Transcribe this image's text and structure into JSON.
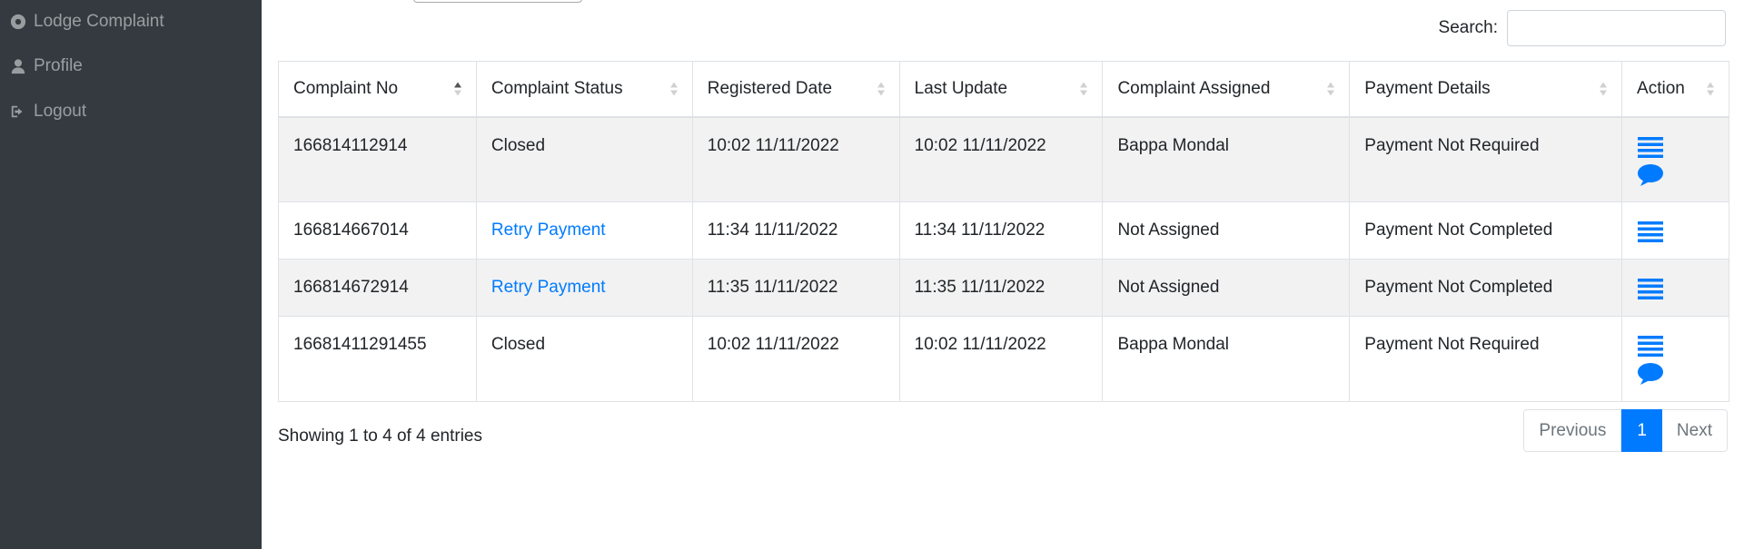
{
  "sidebar": {
    "items": [
      {
        "label": "Lodge Complaint",
        "icon": "dot-circle-icon"
      },
      {
        "label": "Profile",
        "icon": "user-icon"
      },
      {
        "label": "Logout",
        "icon": "sign-out-icon"
      }
    ]
  },
  "search": {
    "label": "Search:",
    "value": ""
  },
  "table": {
    "headers": [
      "Complaint No",
      "Complaint Status",
      "Registered Date",
      "Last Update",
      "Complaint Assigned",
      "Payment Details",
      "Action"
    ],
    "rows": [
      {
        "no": "166814112914",
        "status": "Closed",
        "registered": "10:02 11/11/2022",
        "updated": "10:02 11/11/2022",
        "assigned": "Bappa Mondal",
        "payment": "Payment Not Required"
      },
      {
        "no": "166814667014",
        "status": "Retry Payment",
        "registered": "11:34 11/11/2022",
        "updated": "11:34 11/11/2022",
        "assigned": "Not Assigned",
        "payment": "Payment Not Completed"
      },
      {
        "no": "166814672914",
        "status": "Retry Payment",
        "registered": "11:35 11/11/2022",
        "updated": "11:35 11/11/2022",
        "assigned": "Not Assigned",
        "payment": "Payment Not Completed"
      },
      {
        "no": "16681411291455",
        "status": "Closed",
        "registered": "10:02 11/11/2022",
        "updated": "10:02 11/11/2022",
        "assigned": "Bappa Mondal",
        "payment": "Payment Not Required"
      }
    ]
  },
  "footer": {
    "info": "Showing 1 to 4 of 4 entries",
    "previous": "Previous",
    "current_page": "1",
    "next": "Next"
  },
  "colors": {
    "sidebar_bg": "#343a40",
    "accent": "#007bff"
  }
}
